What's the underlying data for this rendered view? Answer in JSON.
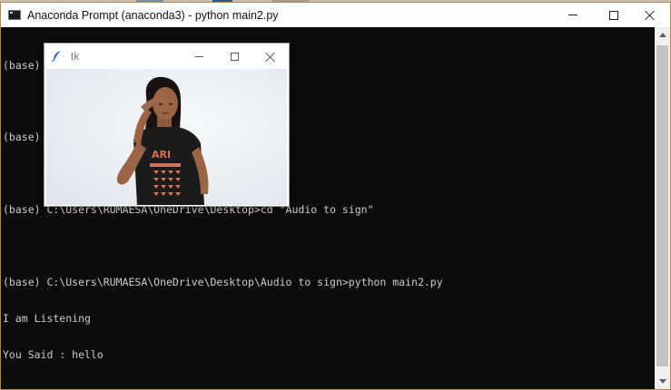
{
  "console": {
    "title": "Anaconda Prompt (anaconda3) - python  main2.py",
    "icon": "console-icon",
    "lines": [
      "(base) C:\\Users\\RUMAESA>cd OneDrive",
      "",
      "(base) C:\\Users\\RUMAESA\\OneDrive>cd Desktop",
      "",
      "(base) C:\\Users\\RUMAESA\\OneDrive\\Desktop>cd \"Audio to sign\"",
      "",
      "(base) C:\\Users\\RUMAESA\\OneDrive\\Desktop\\Audio to sign>python main2.py",
      "I am Listening",
      "You Said : hello"
    ],
    "colors": {
      "background": "#0c0c0c",
      "text": "#cccccc",
      "border": "#b08a50"
    }
  },
  "tk_window": {
    "title": "tk",
    "icon": "feather-icon"
  }
}
